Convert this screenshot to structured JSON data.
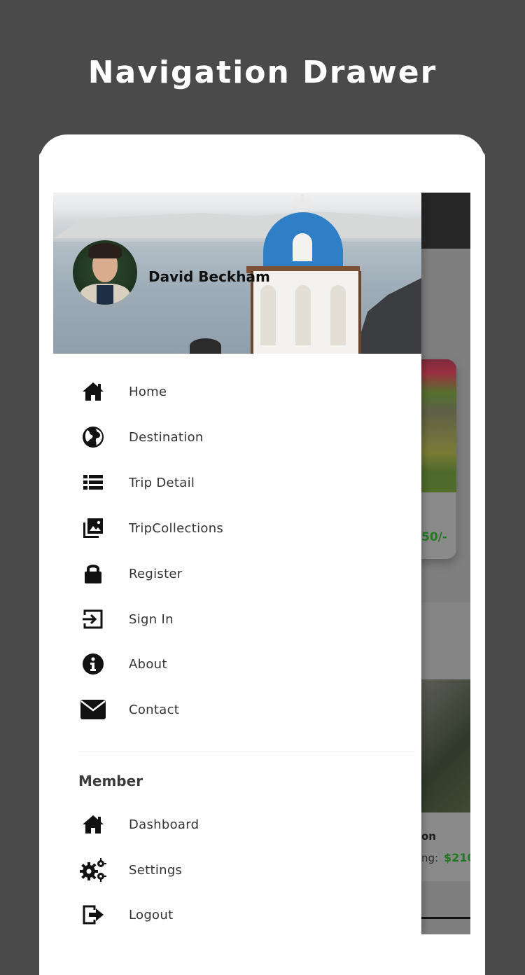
{
  "page": {
    "title": "Navigation Drawer"
  },
  "user": {
    "name": "David Beckham"
  },
  "menu": {
    "items": [
      {
        "label": "Home",
        "icon": "home-icon"
      },
      {
        "label": "Destination",
        "icon": "globe-icon"
      },
      {
        "label": "Trip Detail",
        "icon": "list-icon"
      },
      {
        "label": "TripCollections",
        "icon": "photo-library-icon"
      },
      {
        "label": "Register",
        "icon": "lock-icon"
      },
      {
        "label": "Sign In",
        "icon": "sign-in-icon"
      },
      {
        "label": "About",
        "icon": "info-icon"
      },
      {
        "label": "Contact",
        "icon": "envelope-icon"
      }
    ]
  },
  "member": {
    "title": "Member",
    "items": [
      {
        "label": "Dashboard",
        "icon": "home-icon"
      },
      {
        "label": "Settings",
        "icon": "gears-icon"
      },
      {
        "label": "Logout",
        "icon": "logout-icon"
      }
    ]
  },
  "background": {
    "card1_price": "50/-",
    "card2_title": "on",
    "card2_label": "ng:",
    "card2_price": "$210"
  },
  "colors": {
    "page_bg": "#4a4a4a",
    "price_green": "#1f7a1f",
    "dome_blue": "#2f7fc6"
  }
}
